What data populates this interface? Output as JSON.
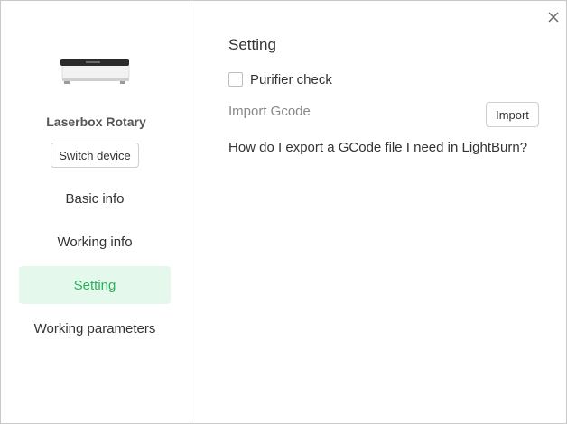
{
  "window": {
    "close_icon": "close-icon"
  },
  "sidebar": {
    "device_image_icon": "laser-engraver-device-image",
    "device_name": "Laserbox Rotary",
    "switch_device_label": "Switch device",
    "items": [
      {
        "label": "Basic info",
        "active": false
      },
      {
        "label": "Working info",
        "active": false
      },
      {
        "label": "Setting",
        "active": true
      },
      {
        "label": "Working parameters",
        "active": false
      }
    ]
  },
  "content": {
    "title": "Setting",
    "purifier_check": {
      "label": "Purifier check",
      "checked": false
    },
    "import_gcode": {
      "label": "Import Gcode",
      "button_label": "Import"
    },
    "help_link": "How do I export a GCode file I need in LightBurn?"
  },
  "colors": {
    "accent": "#26b35a",
    "active_bg": "#e5f8ec",
    "muted_text": "#888888"
  }
}
